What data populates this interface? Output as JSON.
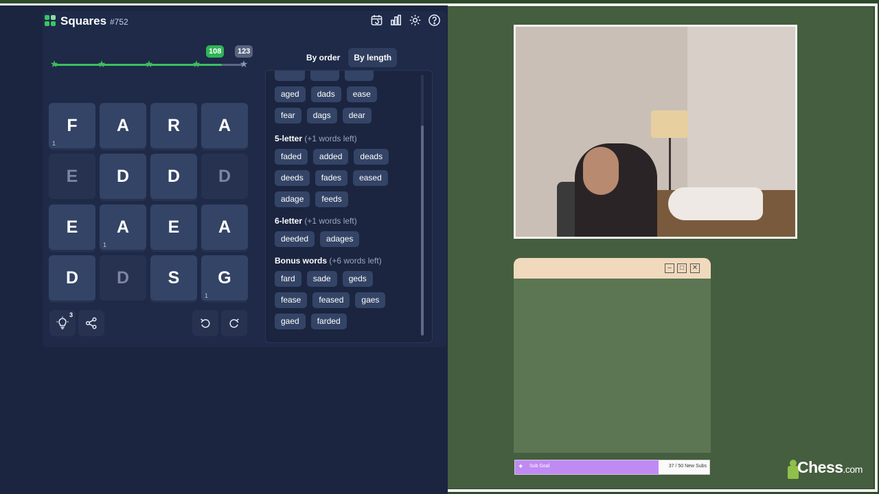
{
  "header": {
    "title": "Squares",
    "puzzle_no": "#752",
    "icons": [
      "calendar-repeat-icon",
      "stats-icon",
      "settings-icon",
      "help-icon"
    ]
  },
  "progress": {
    "current_label": "108",
    "max_label": "123",
    "fraction": 0.878
  },
  "grid": [
    {
      "letter": "F",
      "count": "1",
      "dim": false
    },
    {
      "letter": "A",
      "count": "",
      "dim": false
    },
    {
      "letter": "R",
      "count": "",
      "dim": false
    },
    {
      "letter": "A",
      "count": "",
      "dim": false
    },
    {
      "letter": "E",
      "count": "",
      "dim": true
    },
    {
      "letter": "D",
      "count": "",
      "dim": false
    },
    {
      "letter": "D",
      "count": "",
      "dim": false
    },
    {
      "letter": "D",
      "count": "",
      "dim": true
    },
    {
      "letter": "E",
      "count": "",
      "dim": false
    },
    {
      "letter": "A",
      "count": "1",
      "dim": false
    },
    {
      "letter": "E",
      "count": "",
      "dim": false
    },
    {
      "letter": "A",
      "count": "",
      "dim": false
    },
    {
      "letter": "D",
      "count": "",
      "dim": false
    },
    {
      "letter": "D",
      "count": "",
      "dim": true
    },
    {
      "letter": "S",
      "count": "",
      "dim": false
    },
    {
      "letter": "G",
      "count": "1",
      "dim": false
    }
  ],
  "controls": {
    "hint_count": "3"
  },
  "sort": {
    "by_order": "By order",
    "by_length": "By length"
  },
  "words": {
    "four_letter": [
      "aged",
      "dads",
      "ease",
      "fear",
      "dags",
      "dear"
    ],
    "five_title": "5-letter",
    "five_left": "(+1 words left)",
    "five_letter": [
      "faded",
      "added",
      "deads",
      "deeds",
      "fades",
      "eased",
      "adage",
      "feeds"
    ],
    "six_title": "6-letter",
    "six_left": "(+1 words left)",
    "six_letter": [
      "deeded",
      "adages"
    ],
    "bonus_title": "Bonus words",
    "bonus_left": "(+6 words left)",
    "bonus": [
      "fard",
      "sade",
      "geds",
      "fease",
      "feased",
      "gaes",
      "gaed",
      "farded"
    ]
  },
  "subgoal": {
    "label": "Sub Goal",
    "count": "37 / 50 New Subs",
    "fraction": 0.74
  },
  "brand": {
    "name": "Chess",
    "domain": ".com"
  },
  "colors": {
    "accent_green": "#3cbf5e",
    "tile": "#344466",
    "panel": "#1b2540",
    "subgoal_purple": "#c08af3"
  }
}
